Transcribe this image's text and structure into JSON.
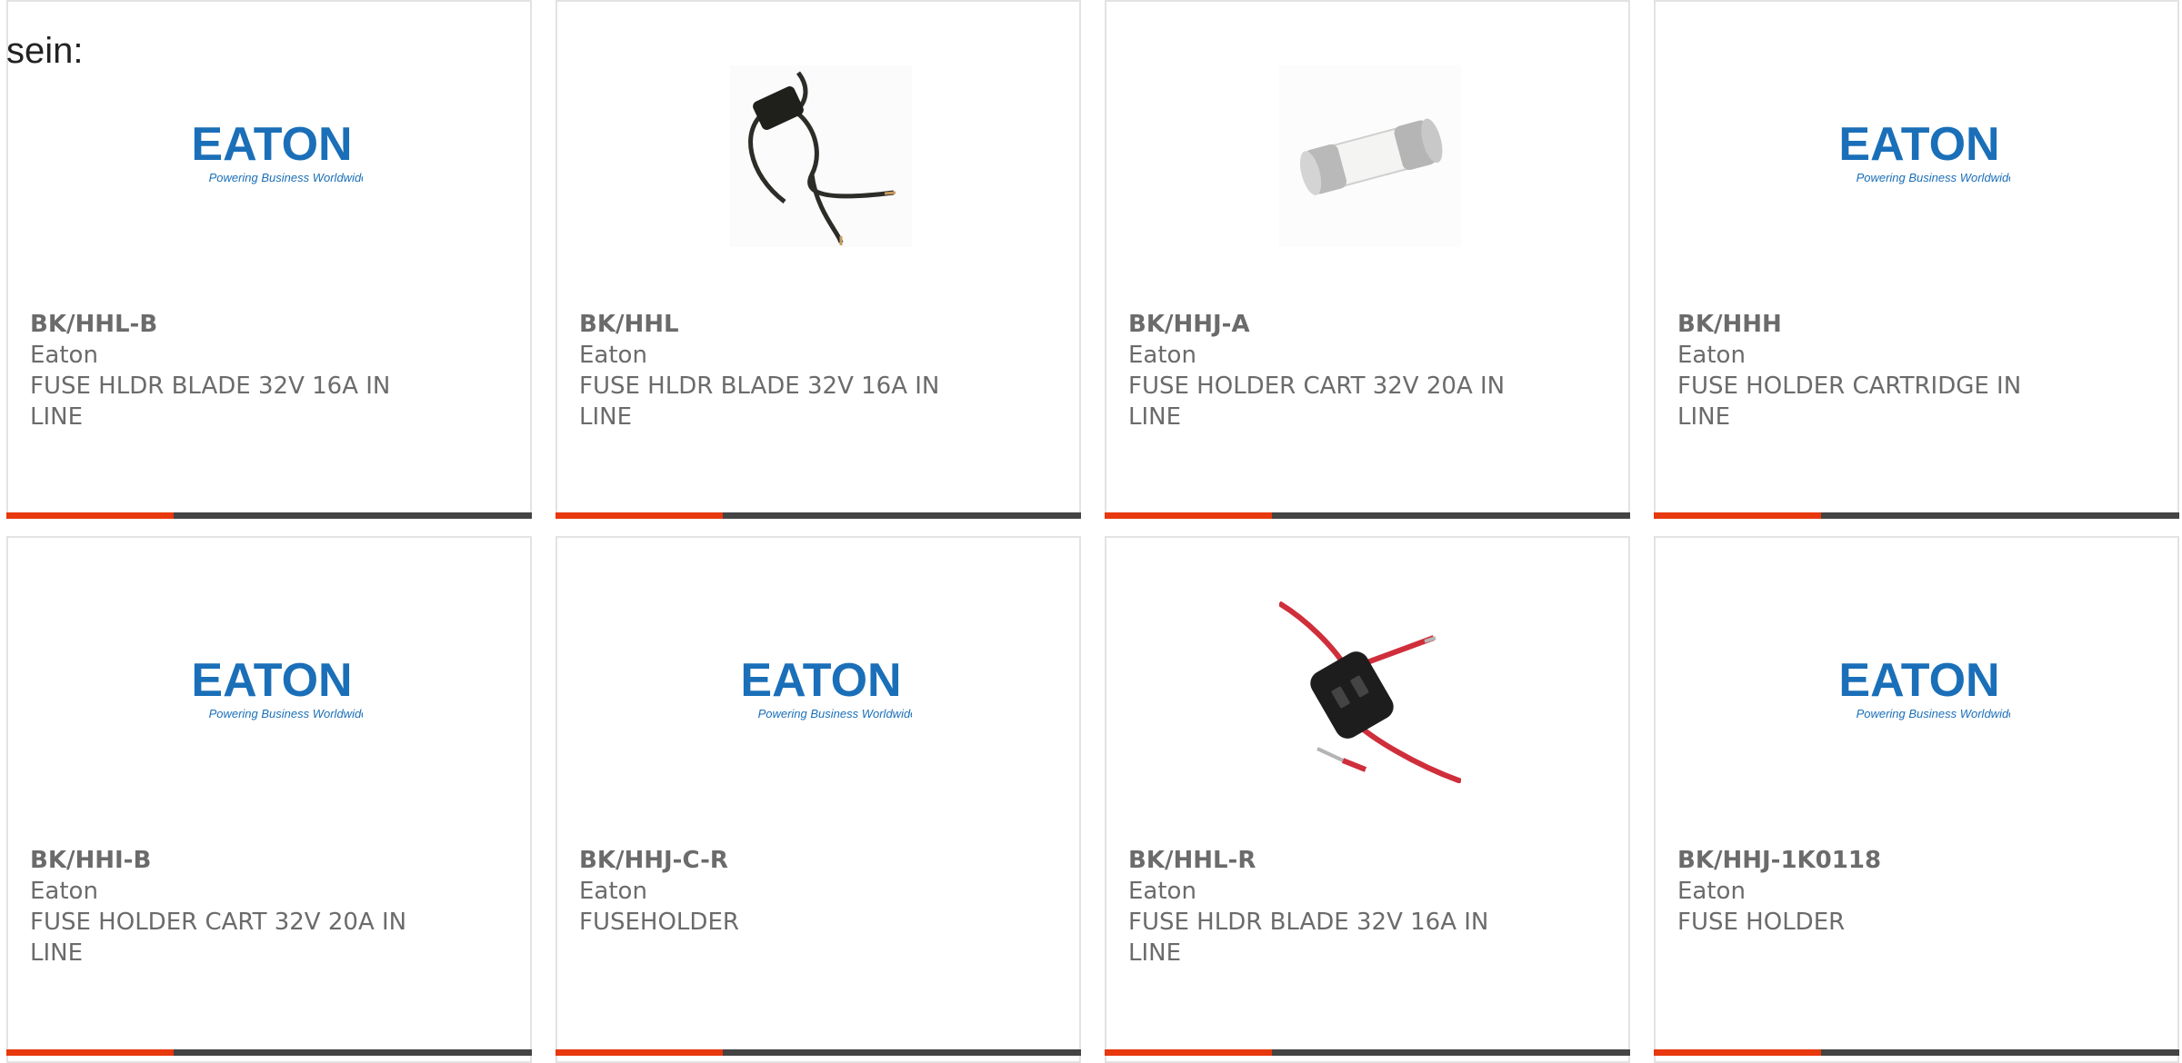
{
  "lead_text": "sein:",
  "colors": {
    "accent": "#e8380d",
    "bar": "#444444",
    "text": "#6b6b6b",
    "eaton_blue": "#1a6fb8"
  },
  "eaton_logo": {
    "wordmark": "EATON",
    "tagline": "Powering Business Worldwide"
  },
  "products": [
    {
      "part_number": "BK/HHL-B",
      "manufacturer": "Eaton",
      "description": "FUSE HLDR BLADE 32V 16A IN LINE",
      "image": "eaton-logo"
    },
    {
      "part_number": "BK/HHL",
      "manufacturer": "Eaton",
      "description": "FUSE HLDR BLADE 32V 16A IN LINE",
      "image": "inline-blade-fuse-holder-photo"
    },
    {
      "part_number": "BK/HHJ-A",
      "manufacturer": "Eaton",
      "description": "FUSE HOLDER CART 32V 20A IN LINE",
      "image": "cartridge-fuse-photo"
    },
    {
      "part_number": "BK/HHH",
      "manufacturer": "Eaton",
      "description": "FUSE HOLDER CARTRIDGE IN LINE",
      "image": "eaton-logo"
    },
    {
      "part_number": "BK/HHI-B",
      "manufacturer": "Eaton",
      "description": "FUSE HOLDER CART 32V 20A IN LINE",
      "image": "eaton-logo"
    },
    {
      "part_number": "BK/HHJ-C-R",
      "manufacturer": "Eaton",
      "description": "FUSEHOLDER",
      "image": "eaton-logo"
    },
    {
      "part_number": "BK/HHL-R",
      "manufacturer": "Eaton",
      "description": "FUSE HLDR BLADE 32V 16A IN LINE",
      "image": "red-wire-fuse-holder-photo"
    },
    {
      "part_number": "BK/HHJ-1K0118",
      "manufacturer": "Eaton",
      "description": "FUSE HOLDER",
      "image": "eaton-logo"
    }
  ]
}
